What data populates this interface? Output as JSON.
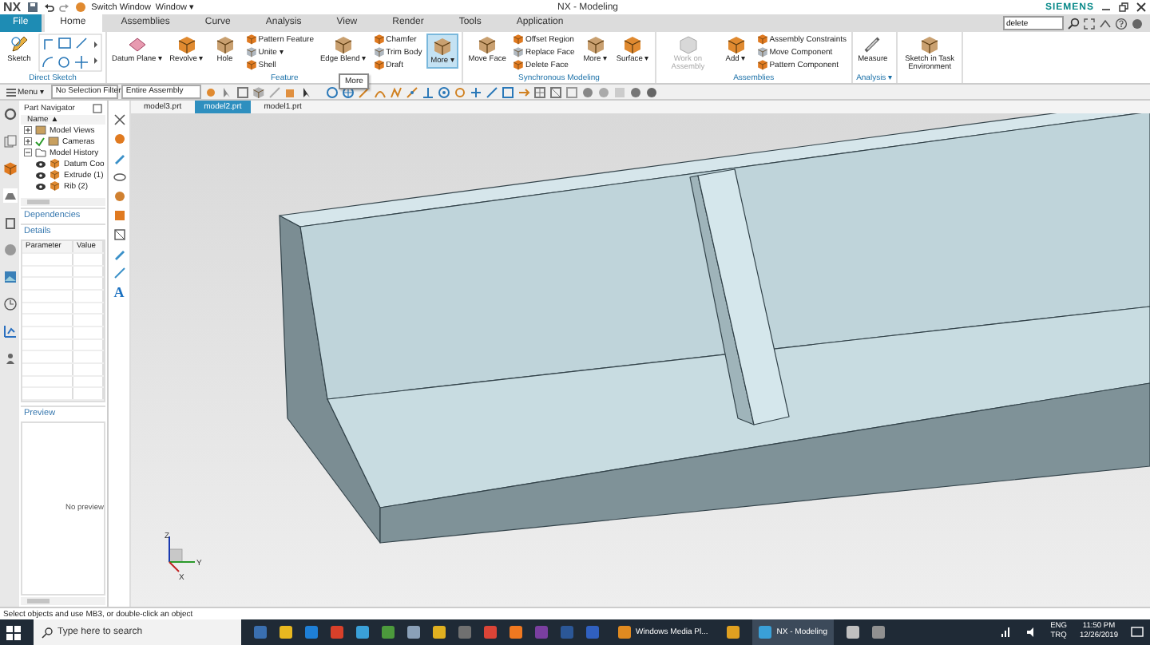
{
  "title_bar": {
    "logo": "NX",
    "switch_window": "Switch Window",
    "window_menu": "Window ▾",
    "title": "NX - Modeling",
    "brand": "SIEMENS"
  },
  "ribbon_tabs": [
    {
      "label": "File",
      "kind": "file",
      "selected": false
    },
    {
      "label": "Home",
      "kind": "tab",
      "selected": true
    },
    {
      "label": "Assemblies",
      "kind": "tab",
      "selected": false
    },
    {
      "label": "Curve",
      "kind": "tab",
      "selected": false
    },
    {
      "label": "Analysis",
      "kind": "tab",
      "selected": false
    },
    {
      "label": "View",
      "kind": "tab",
      "selected": false
    },
    {
      "label": "Render",
      "kind": "tab",
      "selected": false
    },
    {
      "label": "Tools",
      "kind": "tab",
      "selected": false
    },
    {
      "label": "Application",
      "kind": "tab",
      "selected": false
    }
  ],
  "command_search": {
    "value": "delete"
  },
  "ribbon_groups": [
    {
      "label": "Direct Sketch",
      "items": [
        {
          "kind": "large",
          "label": "Sketch",
          "highlighted": false,
          "disabled": false
        },
        {
          "kind": "palette"
        }
      ]
    },
    {
      "label": "Feature",
      "items": [
        {
          "kind": "large",
          "label": "Datum Plane ▾",
          "highlighted": false,
          "disabled": false
        },
        {
          "kind": "large",
          "label": "Revolve ▾",
          "highlighted": false,
          "disabled": false
        },
        {
          "kind": "large",
          "label": "Hole",
          "highlighted": false,
          "disabled": false
        },
        {
          "kind": "stack",
          "items": [
            {
              "label": "Pattern Feature",
              "highlighted": false,
              "disabled": false
            },
            {
              "label": "Unite ▾",
              "highlighted": false,
              "disabled": false
            },
            {
              "label": "Shell",
              "highlighted": false,
              "disabled": false
            }
          ]
        },
        {
          "kind": "large",
          "label": "Edge Blend ▾",
          "highlighted": false,
          "disabled": false
        },
        {
          "kind": "stack",
          "items": [
            {
              "label": "Chamfer",
              "highlighted": false,
              "disabled": false
            },
            {
              "label": "Trim Body",
              "highlighted": false,
              "disabled": false
            },
            {
              "label": "Draft",
              "highlighted": false,
              "disabled": false
            }
          ]
        },
        {
          "kind": "large",
          "label": "More ▾",
          "highlighted": true,
          "disabled": false
        }
      ]
    },
    {
      "label": "Synchronous Modeling",
      "items": [
        {
          "kind": "large",
          "label": "Move Face",
          "highlighted": false,
          "disabled": false
        },
        {
          "kind": "stack",
          "items": [
            {
              "label": "Offset Region",
              "highlighted": false,
              "disabled": false
            },
            {
              "label": "Replace Face",
              "highlighted": false,
              "disabled": false
            },
            {
              "label": "Delete Face",
              "highlighted": false,
              "disabled": false
            }
          ]
        },
        {
          "kind": "large",
          "label": "More ▾",
          "highlighted": false,
          "disabled": false
        },
        {
          "kind": "large",
          "label": "Surface ▾",
          "highlighted": false,
          "disabled": false
        }
      ]
    },
    {
      "label": "Assemblies",
      "items": [
        {
          "kind": "large",
          "label": "Work on Assembly",
          "highlighted": false,
          "disabled": true
        },
        {
          "kind": "large",
          "label": "Add ▾",
          "highlighted": false,
          "disabled": false
        },
        {
          "kind": "stack",
          "items": [
            {
              "label": "Assembly Constraints",
              "highlighted": false,
              "disabled": false
            },
            {
              "label": "Move Component",
              "highlighted": false,
              "disabled": false
            },
            {
              "label": "Pattern Component",
              "highlighted": false,
              "disabled": false
            }
          ]
        }
      ]
    },
    {
      "label": "Analysis ▾",
      "items": [
        {
          "kind": "large",
          "label": "Measure",
          "highlighted": false,
          "disabled": false
        }
      ]
    },
    {
      "items": [
        {
          "kind": "large",
          "label": "Sketch in Task Environment",
          "highlighted": false,
          "disabled": false
        }
      ]
    }
  ],
  "tooltip": "More",
  "selection_bar": {
    "menu": "Menu ▾",
    "filter": "No Selection Filter",
    "scope": "Entire Assembly"
  },
  "document_tabs": [
    {
      "label": "model3.prt",
      "selected": false
    },
    {
      "label": "model2.prt",
      "selected": true
    },
    {
      "label": "model1.prt",
      "selected": false
    }
  ],
  "part_navigator": {
    "title": "Part Navigator",
    "column": "Name ▲",
    "tree": [
      {
        "label": "Model Views",
        "expanded": false,
        "checked": false
      },
      {
        "label": "Cameras",
        "expanded": false,
        "checked": true
      },
      {
        "label": "Model History",
        "expanded": true,
        "checked": false,
        "children": [
          {
            "label": "Datum Coo",
            "checked": false
          },
          {
            "label": "Extrude (1)",
            "checked": false
          },
          {
            "label": "Rib (2)",
            "checked": false
          }
        ]
      }
    ],
    "dependencies": "Dependencies",
    "details": "Details",
    "details_columns": [
      "Parameter",
      "Value"
    ],
    "preview": "Preview",
    "preview_text": "No preview"
  },
  "vertical_toolbar": {
    "text_tool": "A"
  },
  "triad": {
    "z": "Z",
    "y": "Y",
    "x": "X"
  },
  "status_bar": "Select objects and use MB3, or double-click an object",
  "taskbar": {
    "search": {
      "placeholder": "Type here to search"
    },
    "apps": [
      {
        "kind": "icon",
        "color": "#3a6fb0"
      },
      {
        "kind": "icon",
        "color": "#e8b820"
      },
      {
        "kind": "icon",
        "color": "#1e7fd6"
      },
      {
        "kind": "icon",
        "color": "#d8402a"
      },
      {
        "kind": "icon",
        "color": "#3aa0d8"
      },
      {
        "kind": "icon",
        "color": "#4c9a3c"
      },
      {
        "kind": "icon",
        "color": "#8aa0b8"
      },
      {
        "kind": "icon",
        "color": "#e0b020"
      },
      {
        "kind": "icon",
        "color": "#707070"
      },
      {
        "kind": "icon",
        "color": "#db4437"
      },
      {
        "kind": "icon",
        "color": "#f07820"
      },
      {
        "kind": "icon",
        "color": "#7a3fa0"
      },
      {
        "kind": "icon",
        "color": "#2b5797"
      },
      {
        "kind": "icon",
        "color": "#3060c0"
      },
      {
        "kind": "window",
        "label": "Windows Media Pl...",
        "color": "#e08a20",
        "selected": false
      },
      {
        "kind": "icon",
        "color": "#e0a020"
      },
      {
        "kind": "window",
        "label": "NX - Modeling",
        "color": "#3aa0d8",
        "selected": true
      },
      {
        "kind": "icon",
        "color": "#c0c0c0"
      },
      {
        "kind": "icon",
        "color": "#909090"
      }
    ],
    "language": "ENG",
    "region": "TRQ",
    "time": "11:50 PM",
    "date": "12/26/2019"
  }
}
